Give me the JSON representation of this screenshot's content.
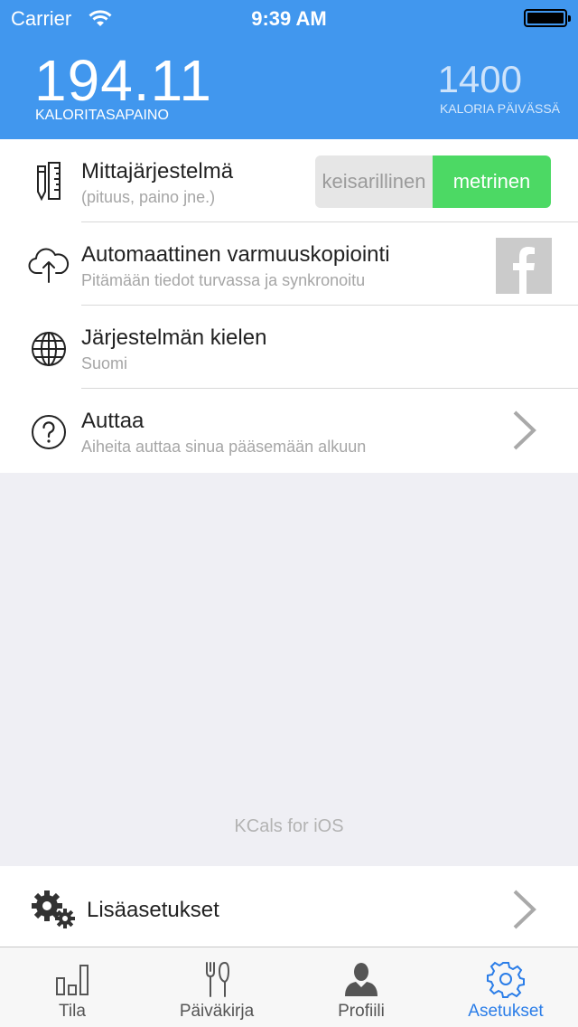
{
  "status_bar": {
    "carrier": "Carrier",
    "time": "9:39 AM"
  },
  "header": {
    "balance_value": "194.11",
    "balance_label": "KALORITASAPAINO",
    "daily_value": "1400",
    "daily_label": "KALORIA PÄIVÄSSÄ"
  },
  "settings": {
    "units": {
      "title": "Mittajärjestelmä",
      "subtitle": "(pituus, paino jne.)",
      "option_imperial": "keisarillinen",
      "option_metric": "metrinen",
      "selected": "metrinen"
    },
    "backup": {
      "title": "Automaattinen varmuuskopiointi",
      "subtitle": "Pitämään tiedot turvassa ja synkronoitu"
    },
    "language": {
      "title": "Järjestelmän kielen",
      "subtitle": "Suomi"
    },
    "help": {
      "title": "Auttaa",
      "subtitle": "Aiheita auttaa sinua pääsemään alkuun"
    }
  },
  "footer_text": "KCals for iOS",
  "more_settings": {
    "title": "Lisäasetukset"
  },
  "tabs": [
    {
      "label": "Tila",
      "icon": "bar-chart-icon"
    },
    {
      "label": "Päiväkirja",
      "icon": "fork-knife-icon"
    },
    {
      "label": "Profiili",
      "icon": "person-icon"
    },
    {
      "label": "Asetukset",
      "icon": "gear-icon",
      "active": true
    }
  ],
  "colors": {
    "header_blue": "#4197ee",
    "toggle_green": "#4cd964",
    "tab_active": "#2a7de8"
  }
}
